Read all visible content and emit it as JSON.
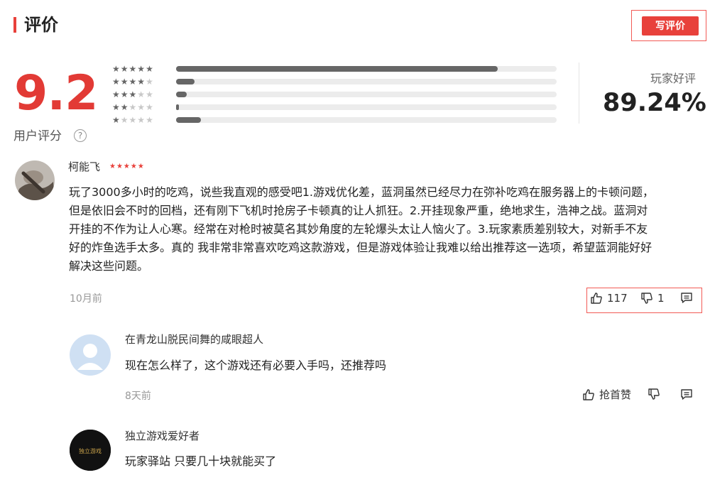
{
  "header": {
    "title": "评价",
    "write_button": "写评价"
  },
  "score": {
    "value": "9.2",
    "label": "用户评分",
    "help": "?"
  },
  "rating_distribution": [
    {
      "stars": 5,
      "fraction": 0.845
    },
    {
      "stars": 4,
      "fraction": 0.048
    },
    {
      "stars": 3,
      "fraction": 0.028
    },
    {
      "stars": 2,
      "fraction": 0.008
    },
    {
      "stars": 1,
      "fraction": 0.065
    }
  ],
  "positive": {
    "label": "玩家好评",
    "value": "89.24%"
  },
  "comments": [
    {
      "user": "柯能飞",
      "stars": 5,
      "lines": [
        "玩了3000多小时的吃鸡，说些我直观的感受吧1.游戏优化差，蓝洞虽然已经尽力在弥补吃鸡在服务器上的卡顿问题，",
        "但是依旧会不时的回档，还有刚下飞机时抢房子卡顿真的让人抓狂。2.开挂现象严重，绝地求生，浩神之战。蓝洞对",
        "开挂的不作为让人心寒。经常在对枪时被莫名其妙角度的左轮爆头太让人恼火了。3.玩家素质差别较大，对新手不友",
        "好的炸鱼选手太多。真的 我非常非常喜欢吃鸡这款游戏，但是游戏体验让我难以给出推荐这一选项，希望蓝洞能好好",
        "解决这些问题。"
      ],
      "time": "10月前",
      "likes": "117",
      "dislikes": "1"
    },
    {
      "user": "在青龙山脱民间舞的咸眼超人",
      "text": "现在怎么样了，这个游戏还有必要入手吗，还推荐吗",
      "time": "8天前",
      "like_label": "抢首赞"
    },
    {
      "user": "独立游戏爱好者",
      "text": "玩家驿站 只要几十块就能买了",
      "avatar_text": "独立游戏"
    }
  ],
  "colors": {
    "accent": "#e8413b",
    "bar_fill": "#666666",
    "bar_track": "#ececec"
  },
  "icons": [
    "help-icon",
    "thumbs-up-icon",
    "thumbs-down-icon",
    "comment-icon",
    "default-avatar-icon"
  ]
}
